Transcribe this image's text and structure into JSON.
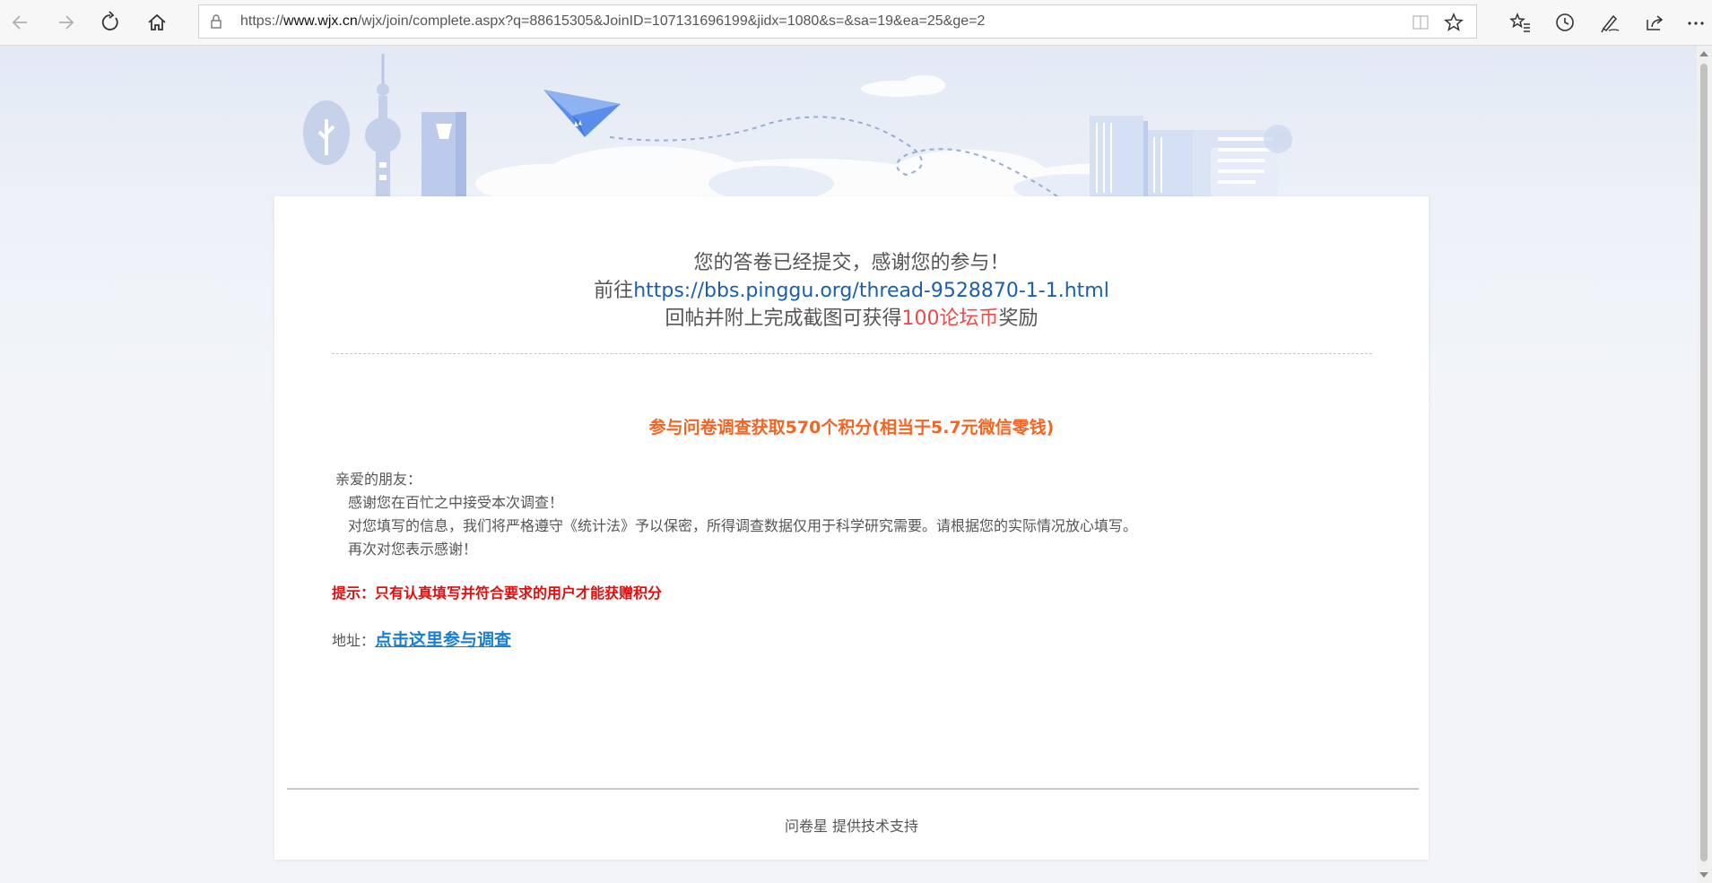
{
  "browser": {
    "url_prefix": "https://",
    "url_domain": "www.wjx.cn",
    "url_rest": "/wjx/join/complete.aspx?q=88615305&JoinID=107131696199&jidx=1080&s=&sa=19&ea=25&ge=2"
  },
  "icons": {
    "back": "back-arrow-icon",
    "forward": "forward-arrow-icon",
    "refresh": "refresh-icon",
    "home": "home-icon",
    "lock": "lock-icon",
    "reading_view": "reading-view-icon",
    "favorite": "star-icon",
    "favorites_list": "favorites-icon",
    "history": "history-icon",
    "notes": "pen-icon",
    "share": "share-icon",
    "more": "more-icon"
  },
  "completion": {
    "line1": "您的答卷已经提交，感谢您的参与！",
    "line2_prefix": "前往",
    "line2_link": "https://bbs.pinggu.org/thread-9528870-1-1.html",
    "line3_prefix": "回帖并附上完成截图可获得",
    "line3_highlight": "100论坛币",
    "line3_suffix": "奖励"
  },
  "promo": {
    "title": "参与问卷调查获取570个积分(相当于5.7元微信零钱)",
    "greeting": "亲爱的朋友：",
    "p1": "感谢您在百忙之中接受本次调查！",
    "p2": "对您填写的信息，我们将严格遵守《统计法》予以保密，所得调查数据仅用于科学研究需要。请根据您的实际情况放心填写。",
    "p3": "再次对您表示感谢！",
    "tip": "提示：只有认真填写并符合要求的用户才能获赠积分",
    "address_label": "地址：",
    "address_link": "点击这里参与调查"
  },
  "footer": {
    "brand": "问卷星",
    "text": " 提供技术支持"
  },
  "colors": {
    "link_blue": "#1b5fad",
    "reward_red": "#f04b4b",
    "promo_orange": "#f26522",
    "tip_red": "#e20e0e",
    "cta_blue": "#1a7fd0"
  }
}
